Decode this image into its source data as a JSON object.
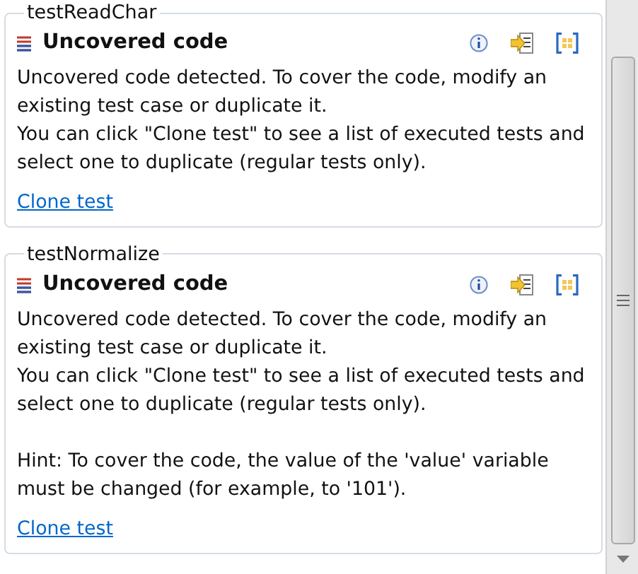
{
  "groups": [
    {
      "title": "testReadChar",
      "heading": "Uncovered code",
      "paragraphs": [
        "Uncovered code detected. To cover the code, modify an existing test case or duplicate it.\nYou can click \"Clone test\" to see a list of executed tests and select one to duplicate (regular tests only)."
      ],
      "link": "Clone test"
    },
    {
      "title": "testNormalize",
      "heading": "Uncovered code",
      "paragraphs": [
        "Uncovered code detected. To cover the code, modify an existing test case or duplicate it.\nYou can click \"Clone test\" to see a list of executed tests and select one to duplicate (regular tests only).",
        "Hint: To cover the code, the value of the 'value' variable must be changed (for example, to '101')."
      ],
      "link": "Clone test"
    }
  ]
}
